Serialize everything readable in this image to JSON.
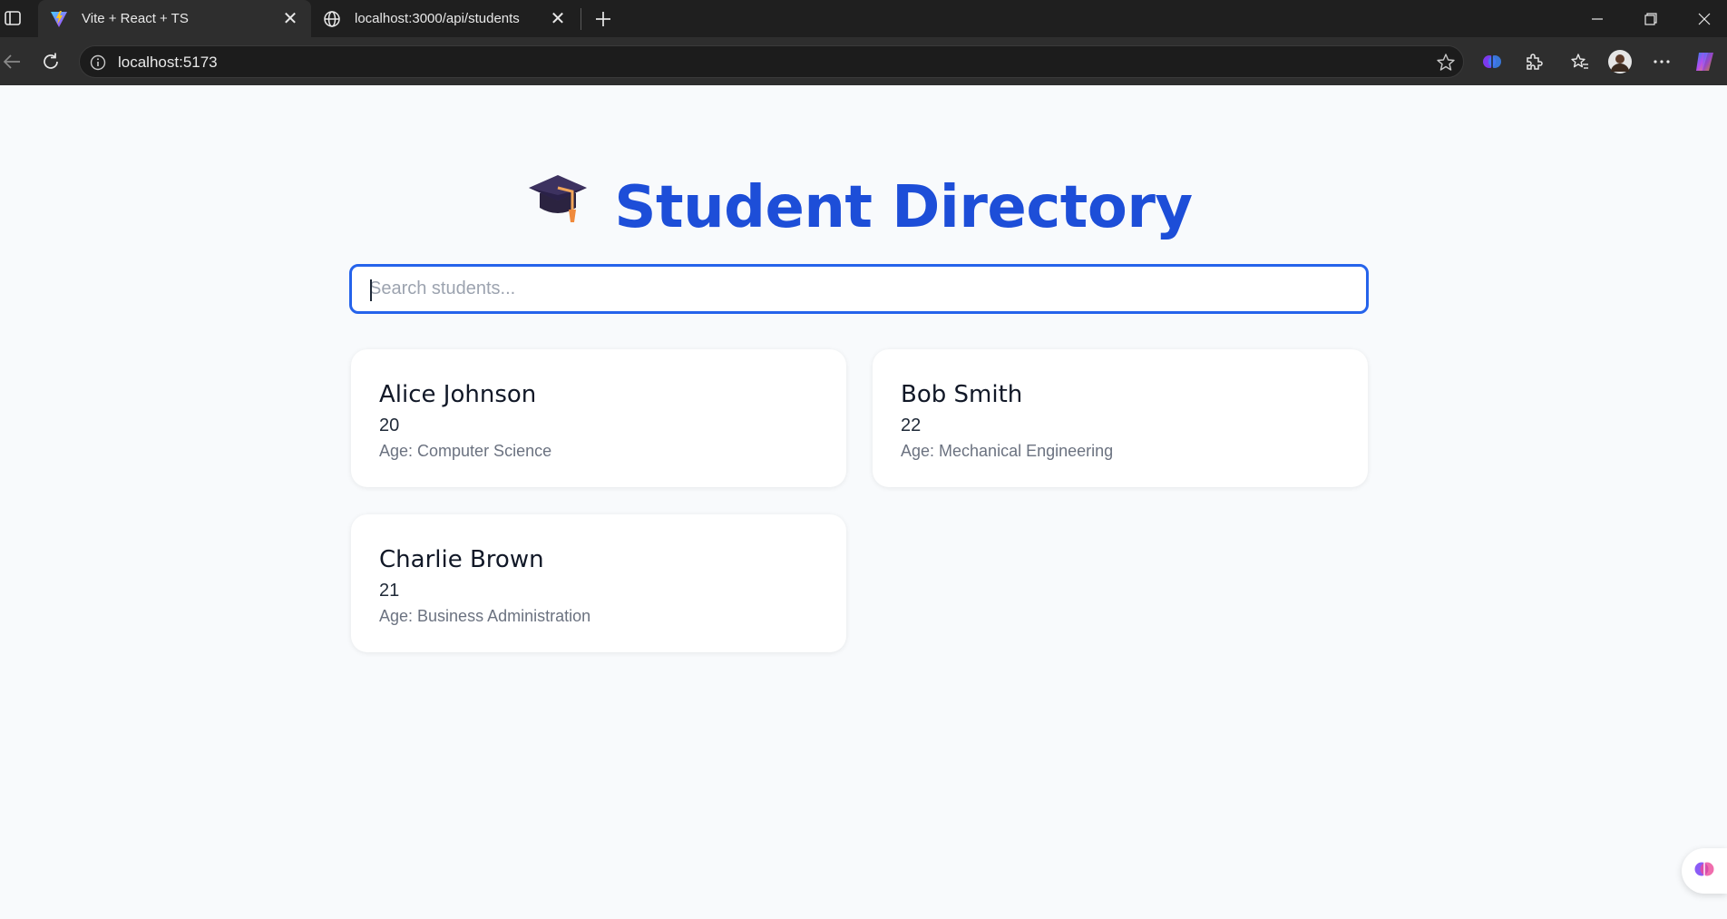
{
  "browser": {
    "tabs": [
      {
        "title": "Vite + React + TS",
        "icon": "vite-icon",
        "active": true
      },
      {
        "title": "localhost:3000/api/students",
        "icon": "globe-icon",
        "active": false
      }
    ],
    "url": "localhost:5173"
  },
  "page": {
    "title": "Student Directory",
    "title_icon": "graduation-cap-icon",
    "search_placeholder": "Search students...",
    "search_value": ""
  },
  "students": [
    {
      "name": "Alice Johnson",
      "number": "20",
      "detail": "Age: Computer Science"
    },
    {
      "name": "Bob Smith",
      "number": "22",
      "detail": "Age: Mechanical Engineering"
    },
    {
      "name": "Charlie Brown",
      "number": "21",
      "detail": "Age: Business Administration"
    }
  ],
  "colors": {
    "accent": "#1d4ed8",
    "search_border": "#2563eb",
    "page_bg": "#f8fafc",
    "chrome_dark": "#1f1f1f"
  }
}
